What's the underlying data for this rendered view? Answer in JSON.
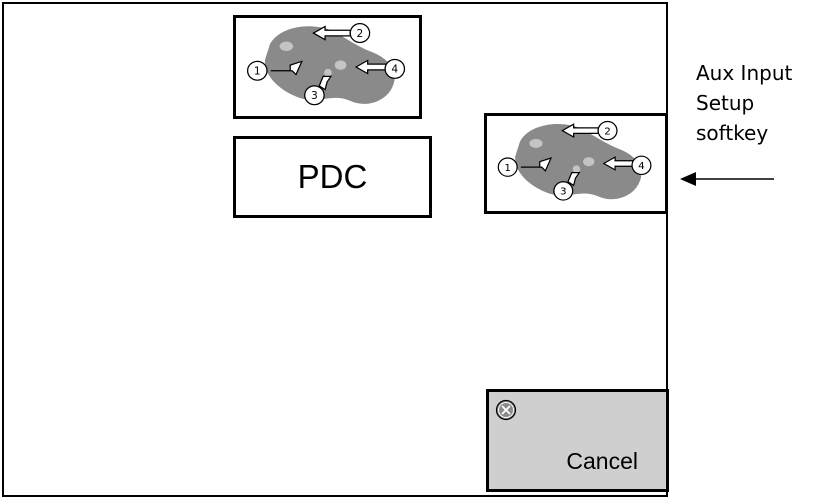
{
  "pdc_label": "PDC",
  "cancel": {
    "label": "Cancel",
    "icon": "cancel-x-icon"
  },
  "callout": {
    "lines": [
      "Aux Input",
      "Setup",
      "softkey"
    ]
  },
  "thumbnail": {
    "icon": "joystick-diagram-icon",
    "labels": [
      "1",
      "2",
      "3",
      "4"
    ]
  },
  "colors": {
    "cancel_bg": "#cfcfcf",
    "blob": "#8a8a8a",
    "border": "#000000"
  }
}
